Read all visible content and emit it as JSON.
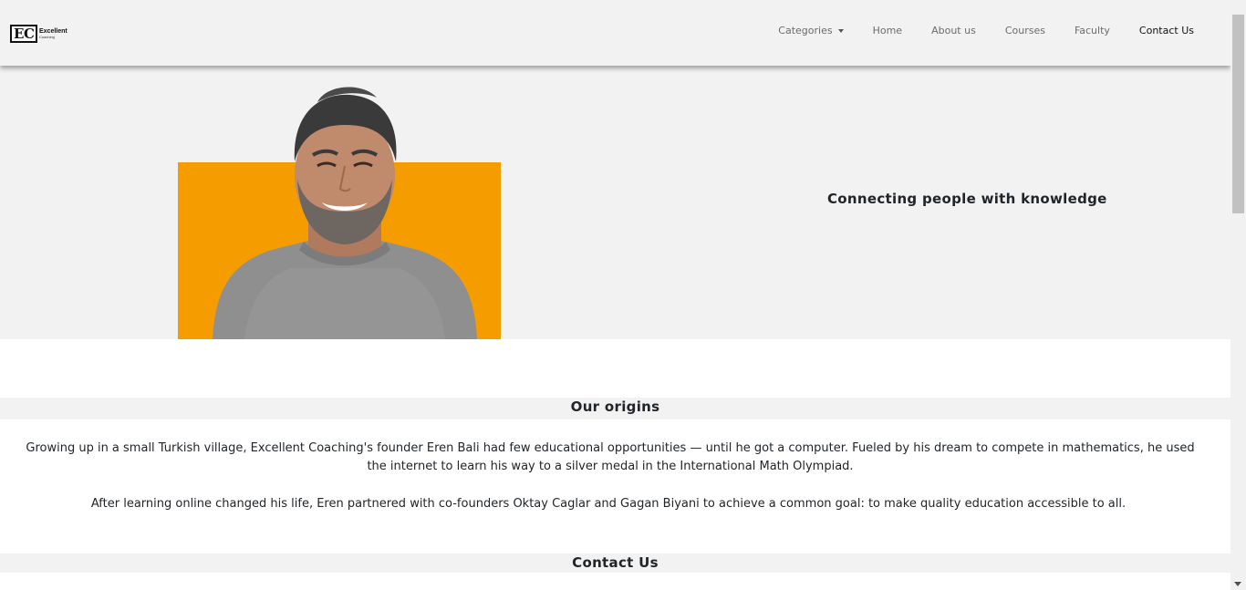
{
  "brand": {
    "logo_mark": "EC",
    "logo_letter_1": "E",
    "logo_letter_2": "C",
    "name": "Excellent",
    "subname": "Coaching"
  },
  "nav": {
    "categories": "Categories",
    "home": "Home",
    "about": "About us",
    "courses": "Courses",
    "faculty": "Faculty",
    "contact": "Contact Us"
  },
  "hero": {
    "tagline": "Connecting people with knowledge",
    "accent_color": "#f59d00"
  },
  "origins": {
    "title": "Our origins",
    "paragraph_1": "Growing up in a small Turkish village, Excellent Coaching's founder Eren Bali had few educational opportunities — until he got a computer. Fueled by his dream to compete in mathematics, he used the internet to learn his way to a silver medal in the International Math Olympiad.",
    "paragraph_2": "After learning online changed his life, Eren partnered with co-founders Oktay Caglar and Gagan Biyani to achieve a common goal: to make quality education accessible to all."
  },
  "contact": {
    "title": "Contact Us"
  }
}
